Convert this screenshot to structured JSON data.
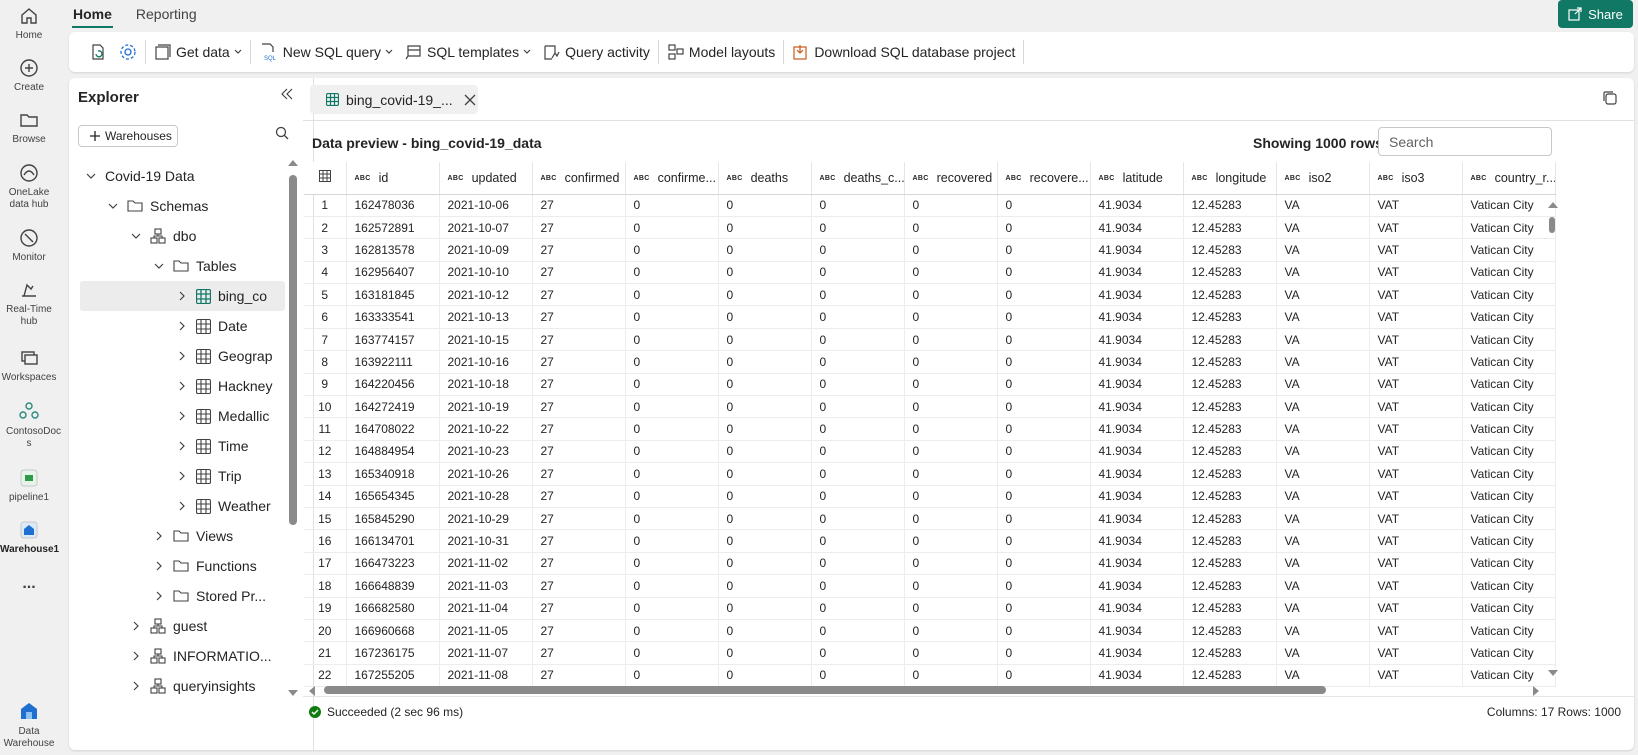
{
  "rail": [
    {
      "name": "home",
      "label": "Home",
      "icon": "home-icon"
    },
    {
      "name": "create",
      "label": "Create",
      "icon": "plus-circle-icon"
    },
    {
      "name": "browse",
      "label": "Browse",
      "icon": "folder-icon"
    },
    {
      "name": "onelake",
      "label": "OneLake data hub",
      "icon": "onelake-icon"
    },
    {
      "name": "monitor",
      "label": "Monitor",
      "icon": "monitor-icon"
    },
    {
      "name": "realtime",
      "label": "Real-Time hub",
      "icon": "realtime-icon"
    },
    {
      "name": "workspaces",
      "label": "Workspaces",
      "icon": "workspaces-icon"
    },
    {
      "name": "contosodocs",
      "label": "ContosoDoc s",
      "icon": "contoso-icon"
    },
    {
      "name": "pipeline1",
      "label": "pipeline1",
      "icon": "pipeline-icon"
    },
    {
      "name": "warehouse1",
      "label": "Warehouse1",
      "icon": "warehouse-icon"
    },
    {
      "name": "more",
      "label": "...",
      "icon": "more-icon"
    },
    {
      "name": "datawarehouse",
      "label": "Data Warehouse",
      "icon": "data-warehouse-icon"
    }
  ],
  "tabs": [
    "Home",
    "Reporting"
  ],
  "share_label": "Share",
  "ribbon": {
    "get_data": "Get data",
    "new_sql_query": "New SQL query",
    "sql_templates": "SQL templates",
    "query_activity": "Query activity",
    "model_layouts": "Model layouts",
    "download_project": "Download SQL database project"
  },
  "explorer": {
    "title": "Explorer",
    "add_warehouses": "Warehouses",
    "tree": [
      {
        "label": "Covid-19 Data",
        "icon": "none"
      },
      {
        "label": "Schemas",
        "icon": "folder"
      },
      {
        "label": "dbo",
        "icon": "schema"
      },
      {
        "label": "Tables",
        "icon": "folder"
      },
      {
        "label": "bing_co",
        "icon": "table"
      },
      {
        "label": "Date",
        "icon": "table"
      },
      {
        "label": "Geograp",
        "icon": "table"
      },
      {
        "label": "Hackney",
        "icon": "table"
      },
      {
        "label": "Medallic",
        "icon": "table"
      },
      {
        "label": "Time",
        "icon": "table"
      },
      {
        "label": "Trip",
        "icon": "table"
      },
      {
        "label": "Weather",
        "icon": "table"
      },
      {
        "label": "Views",
        "icon": "folder"
      },
      {
        "label": "Functions",
        "icon": "folder"
      },
      {
        "label": "Stored Pr...",
        "icon": "folder"
      },
      {
        "label": "guest",
        "icon": "schema"
      },
      {
        "label": "INFORMATIO...",
        "icon": "schema"
      },
      {
        "label": "queryinsights",
        "icon": "schema"
      }
    ]
  },
  "doc_tab": "bing_covid-19_...",
  "preview_title": "Data preview - bing_covid-19_data",
  "rows_label": "Showing 1000 rows",
  "search_placeholder": "Search",
  "column_type_label": "ABC",
  "columns": [
    "id",
    "updated",
    "confirmed",
    "confirme...",
    "deaths",
    "deaths_c...",
    "recovered",
    "recovere...",
    "latitude",
    "longitude",
    "iso2",
    "iso3",
    "country_r..."
  ],
  "rows": [
    [
      "1",
      "162478036",
      "2021-10-06",
      "27",
      "0",
      "0",
      "0",
      "0",
      "0",
      "41.9034",
      "12.45283",
      "VA",
      "VAT",
      "Vatican City"
    ],
    [
      "2",
      "162572891",
      "2021-10-07",
      "27",
      "0",
      "0",
      "0",
      "0",
      "0",
      "41.9034",
      "12.45283",
      "VA",
      "VAT",
      "Vatican City"
    ],
    [
      "3",
      "162813578",
      "2021-10-09",
      "27",
      "0",
      "0",
      "0",
      "0",
      "0",
      "41.9034",
      "12.45283",
      "VA",
      "VAT",
      "Vatican City"
    ],
    [
      "4",
      "162956407",
      "2021-10-10",
      "27",
      "0",
      "0",
      "0",
      "0",
      "0",
      "41.9034",
      "12.45283",
      "VA",
      "VAT",
      "Vatican City"
    ],
    [
      "5",
      "163181845",
      "2021-10-12",
      "27",
      "0",
      "0",
      "0",
      "0",
      "0",
      "41.9034",
      "12.45283",
      "VA",
      "VAT",
      "Vatican City"
    ],
    [
      "6",
      "163333541",
      "2021-10-13",
      "27",
      "0",
      "0",
      "0",
      "0",
      "0",
      "41.9034",
      "12.45283",
      "VA",
      "VAT",
      "Vatican City"
    ],
    [
      "7",
      "163774157",
      "2021-10-15",
      "27",
      "0",
      "0",
      "0",
      "0",
      "0",
      "41.9034",
      "12.45283",
      "VA",
      "VAT",
      "Vatican City"
    ],
    [
      "8",
      "163922111",
      "2021-10-16",
      "27",
      "0",
      "0",
      "0",
      "0",
      "0",
      "41.9034",
      "12.45283",
      "VA",
      "VAT",
      "Vatican City"
    ],
    [
      "9",
      "164220456",
      "2021-10-18",
      "27",
      "0",
      "0",
      "0",
      "0",
      "0",
      "41.9034",
      "12.45283",
      "VA",
      "VAT",
      "Vatican City"
    ],
    [
      "10",
      "164272419",
      "2021-10-19",
      "27",
      "0",
      "0",
      "0",
      "0",
      "0",
      "41.9034",
      "12.45283",
      "VA",
      "VAT",
      "Vatican City"
    ],
    [
      "11",
      "164708022",
      "2021-10-22",
      "27",
      "0",
      "0",
      "0",
      "0",
      "0",
      "41.9034",
      "12.45283",
      "VA",
      "VAT",
      "Vatican City"
    ],
    [
      "12",
      "164884954",
      "2021-10-23",
      "27",
      "0",
      "0",
      "0",
      "0",
      "0",
      "41.9034",
      "12.45283",
      "VA",
      "VAT",
      "Vatican City"
    ],
    [
      "13",
      "165340918",
      "2021-10-26",
      "27",
      "0",
      "0",
      "0",
      "0",
      "0",
      "41.9034",
      "12.45283",
      "VA",
      "VAT",
      "Vatican City"
    ],
    [
      "14",
      "165654345",
      "2021-10-28",
      "27",
      "0",
      "0",
      "0",
      "0",
      "0",
      "41.9034",
      "12.45283",
      "VA",
      "VAT",
      "Vatican City"
    ],
    [
      "15",
      "165845290",
      "2021-10-29",
      "27",
      "0",
      "0",
      "0",
      "0",
      "0",
      "41.9034",
      "12.45283",
      "VA",
      "VAT",
      "Vatican City"
    ],
    [
      "16",
      "166134701",
      "2021-10-31",
      "27",
      "0",
      "0",
      "0",
      "0",
      "0",
      "41.9034",
      "12.45283",
      "VA",
      "VAT",
      "Vatican City"
    ],
    [
      "17",
      "166473223",
      "2021-11-02",
      "27",
      "0",
      "0",
      "0",
      "0",
      "0",
      "41.9034",
      "12.45283",
      "VA",
      "VAT",
      "Vatican City"
    ],
    [
      "18",
      "166648839",
      "2021-11-03",
      "27",
      "0",
      "0",
      "0",
      "0",
      "0",
      "41.9034",
      "12.45283",
      "VA",
      "VAT",
      "Vatican City"
    ],
    [
      "19",
      "166682580",
      "2021-11-04",
      "27",
      "0",
      "0",
      "0",
      "0",
      "0",
      "41.9034",
      "12.45283",
      "VA",
      "VAT",
      "Vatican City"
    ],
    [
      "20",
      "166960668",
      "2021-11-05",
      "27",
      "0",
      "0",
      "0",
      "0",
      "0",
      "41.9034",
      "12.45283",
      "VA",
      "VAT",
      "Vatican City"
    ],
    [
      "21",
      "167236175",
      "2021-11-07",
      "27",
      "0",
      "0",
      "0",
      "0",
      "0",
      "41.9034",
      "12.45283",
      "VA",
      "VAT",
      "Vatican City"
    ],
    [
      "22",
      "167255205",
      "2021-11-08",
      "27",
      "0",
      "0",
      "0",
      "0",
      "0",
      "41.9034",
      "12.45283",
      "VA",
      "VAT",
      "Vatican City"
    ]
  ],
  "status_text": "Succeeded (2 sec 96 ms)",
  "status_summary": "Columns: 17 Rows: 1000",
  "colors": {
    "accent": "#117865",
    "success": "#107c10"
  }
}
